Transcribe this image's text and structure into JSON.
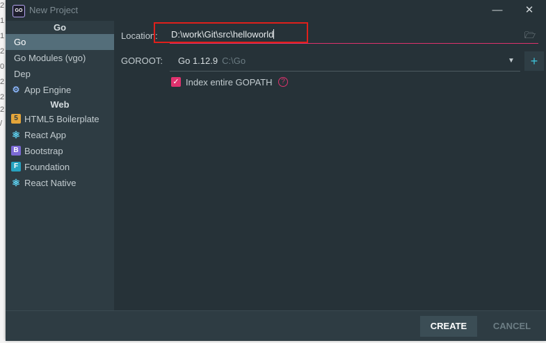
{
  "background": {
    "left_digits": [
      "2",
      "1",
      "1",
      "2",
      "0",
      "2",
      "2",
      "2",
      "/"
    ]
  },
  "window": {
    "title": "New Project",
    "app_icon_text": "GO",
    "minimize": "—",
    "close": "✕"
  },
  "sidebar": {
    "groups": [
      {
        "header": "Go",
        "items": [
          {
            "label": "Go",
            "selected": true,
            "icon": ""
          },
          {
            "label": "Go Modules (vgo)",
            "icon": ""
          },
          {
            "label": "Dep",
            "icon": ""
          },
          {
            "label": "App Engine",
            "icon": "app-engine-icon"
          }
        ]
      },
      {
        "header": "Web",
        "items": [
          {
            "label": "HTML5 Boilerplate",
            "icon": "html5-icon"
          },
          {
            "label": "React App",
            "icon": "react-icon"
          },
          {
            "label": "Bootstrap",
            "icon": "bootstrap-icon"
          },
          {
            "label": "Foundation",
            "icon": "foundation-icon"
          },
          {
            "label": "React Native",
            "icon": "react-icon"
          }
        ]
      }
    ]
  },
  "form": {
    "location_label": "Location:",
    "location_value": "D:\\work\\Git\\src\\helloworld",
    "goroot_label": "GOROOT:",
    "goroot_version": "Go 1.12.9",
    "goroot_path": "C:\\Go",
    "checkbox_label": "Index entire GOPATH",
    "checkbox_checked": true
  },
  "footer": {
    "create": "CREATE",
    "cancel": "CANCEL"
  },
  "colors": {
    "accent": "#e0326e",
    "highlight_box": "#e0201b",
    "selection": "#546e7a",
    "plus": "#3ec2d8"
  }
}
